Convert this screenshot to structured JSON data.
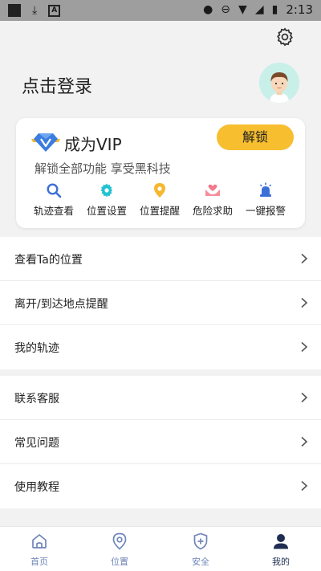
{
  "status_bar": {
    "time": "2:13"
  },
  "header": {
    "login_text": "点击登录"
  },
  "vip": {
    "title": "成为VIP",
    "subtitle": "解锁全部功能 享受黑科技",
    "unlock_label": "解锁",
    "features": [
      {
        "label": "轨迹查看",
        "icon": "search-icon",
        "color": "#3b6fd8"
      },
      {
        "label": "位置设置",
        "icon": "gear-icon",
        "color": "#23c2cf"
      },
      {
        "label": "位置提醒",
        "icon": "location-pin-icon",
        "color": "#f5b82e"
      },
      {
        "label": "危险求助",
        "icon": "help-hands-icon",
        "color": "#f27a8a"
      },
      {
        "label": "一键报警",
        "icon": "alarm-icon",
        "color": "#3b6fd8"
      }
    ]
  },
  "menu_group_1": [
    {
      "label": "查看Ta的位置"
    },
    {
      "label": "离开/到达地点提醒"
    },
    {
      "label": "我的轨迹"
    }
  ],
  "menu_group_2": [
    {
      "label": "联系客服"
    },
    {
      "label": "常见问题"
    },
    {
      "label": "使用教程"
    }
  ],
  "tabbar": {
    "tabs": [
      {
        "label": "首页",
        "icon": "home-icon",
        "active": false
      },
      {
        "label": "位置",
        "icon": "location-icon",
        "active": false
      },
      {
        "label": "安全",
        "icon": "shield-icon",
        "active": false
      },
      {
        "label": "我的",
        "icon": "user-icon",
        "active": true
      }
    ]
  },
  "colors": {
    "accent": "#f7be2f",
    "tab_inactive": "#6f85b9",
    "tab_active": "#1f2d52"
  }
}
